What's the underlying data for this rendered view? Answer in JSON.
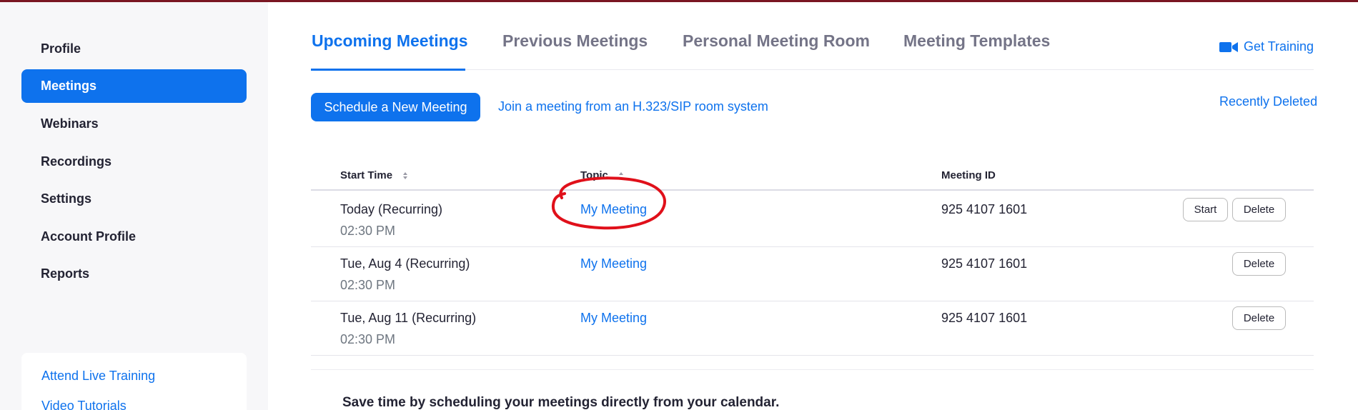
{
  "sidebar": {
    "items": [
      {
        "label": "Profile"
      },
      {
        "label": "Meetings"
      },
      {
        "label": "Webinars"
      },
      {
        "label": "Recordings"
      },
      {
        "label": "Settings"
      },
      {
        "label": "Account Profile"
      },
      {
        "label": "Reports"
      }
    ],
    "links": {
      "attend_live_training": "Attend Live Training",
      "video_tutorials": "Video Tutorials"
    }
  },
  "tabs": [
    {
      "label": "Upcoming Meetings"
    },
    {
      "label": "Previous Meetings"
    },
    {
      "label": "Personal Meeting Room"
    },
    {
      "label": "Meeting Templates"
    }
  ],
  "header": {
    "get_training": "Get Training",
    "recently_deleted": "Recently Deleted"
  },
  "actions": {
    "schedule_button": "Schedule a New Meeting",
    "join_sip_link": "Join a meeting from an H.323/SIP room system"
  },
  "table": {
    "columns": {
      "start_time": "Start Time",
      "topic": "Topic",
      "meeting_id": "Meeting ID"
    },
    "rows": [
      {
        "date": "Today (Recurring)",
        "time": "02:30 PM",
        "topic": "My Meeting",
        "meeting_id": "925 4107 1601",
        "start_label": "Start",
        "delete_label": "Delete"
      },
      {
        "date": "Tue, Aug 4 (Recurring)",
        "time": "02:30 PM",
        "topic": "My Meeting",
        "meeting_id": "925 4107 1601",
        "delete_label": "Delete"
      },
      {
        "date": "Tue, Aug 11 (Recurring)",
        "time": "02:30 PM",
        "topic": "My Meeting",
        "meeting_id": "925 4107 1601",
        "delete_label": "Delete"
      }
    ]
  },
  "calendar_promo": "Save time by scheduling your meetings directly from your calendar.",
  "colors": {
    "accent": "#0e72ed",
    "top_bar": "#7a1622",
    "annotation": "#e0101a"
  }
}
